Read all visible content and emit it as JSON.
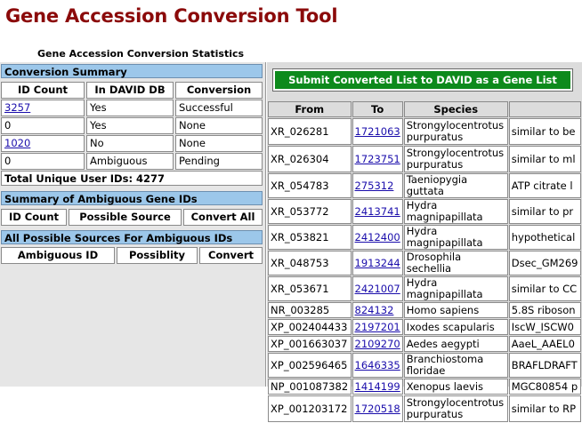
{
  "page_title": "Gene Accession Conversion Tool",
  "stats_title": "Gene Accession Conversion Statistics",
  "conversion_summary": {
    "heading": "Conversion Summary",
    "columns": [
      "ID Count",
      "In DAVID DB",
      "Conversion"
    ],
    "rows": [
      {
        "count": "3257",
        "in_db": "Yes",
        "conversion": "Successful",
        "link": true
      },
      {
        "count": "0",
        "in_db": "Yes",
        "conversion": "None",
        "link": false
      },
      {
        "count": "1020",
        "in_db": "No",
        "conversion": "None",
        "link": true
      },
      {
        "count": "0",
        "in_db": "Ambiguous",
        "conversion": "Pending",
        "link": false
      }
    ],
    "total": "Total Unique User IDs: 4277"
  },
  "ambiguous_summary": {
    "heading": "Summary of Ambiguous Gene IDs",
    "columns": [
      "ID Count",
      "Possible Source",
      "Convert All"
    ]
  },
  "ambiguous_sources": {
    "heading": "All Possible Sources For Ambiguous IDs",
    "columns": [
      "Ambiguous ID",
      "Possiblity",
      "Convert"
    ]
  },
  "submit_label": "Submit Converted List to DAVID as a Gene List",
  "grid": {
    "columns": [
      "From",
      "To",
      "Species",
      ""
    ],
    "rows": [
      {
        "from": "XR_026281",
        "to": "1721063",
        "species": "Strongylocentrotus purpuratus",
        "desc": "similar to be"
      },
      {
        "from": "XR_026304",
        "to": "1723751",
        "species": "Strongylocentrotus purpuratus",
        "desc": "similar to ml"
      },
      {
        "from": "XR_054783",
        "to": "275312",
        "species": "Taeniopygia guttata",
        "desc": "ATP citrate l"
      },
      {
        "from": "XR_053772",
        "to": "2413741",
        "species": "Hydra magnipapillata",
        "desc": "similar to pr"
      },
      {
        "from": "XR_053821",
        "to": "2412400",
        "species": "Hydra magnipapillata",
        "desc": "hypothetical"
      },
      {
        "from": "XR_048753",
        "to": "1913244",
        "species": "Drosophila sechellia",
        "desc": "Dsec_GM269"
      },
      {
        "from": "XR_053671",
        "to": "2421007",
        "species": "Hydra magnipapillata",
        "desc": "similar to CC"
      },
      {
        "from": "NR_003285",
        "to": "824132",
        "species": "Homo sapiens",
        "desc": "5.8S riboson"
      },
      {
        "from": "XP_002404433",
        "to": "2197201",
        "species": "Ixodes scapularis",
        "desc": "IscW_ISCW0"
      },
      {
        "from": "XP_001663037",
        "to": "2109270",
        "species": "Aedes aegypti",
        "desc": "AaeL_AAEL0"
      },
      {
        "from": "XP_002596465",
        "to": "1646335",
        "species": "Branchiostoma floridae",
        "desc": "BRAFLDRAFT"
      },
      {
        "from": "NP_001087382",
        "to": "1414199",
        "species": "Xenopus laevis",
        "desc": "MGC80854 p"
      },
      {
        "from": "XP_001203172",
        "to": "1720518",
        "species": "Strongylocentrotus purpuratus",
        "desc": "similar to RP"
      }
    ]
  }
}
